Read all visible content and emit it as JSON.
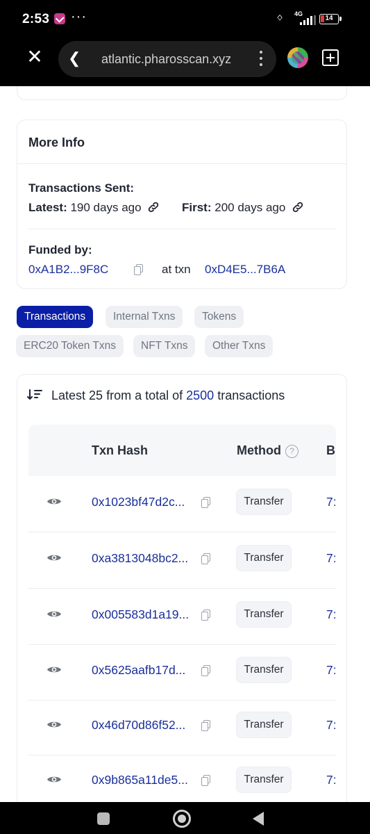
{
  "status_bar": {
    "time": "2:53",
    "dots": "···",
    "network": "4G",
    "battery": "14"
  },
  "browser": {
    "url": "atlantic.pharosscan.xyz"
  },
  "more_info": {
    "title": "More Info",
    "transactions_sent_label": "Transactions Sent:",
    "latest_label": "Latest:",
    "latest_value": "190 days ago",
    "first_label": "First:",
    "first_value": "200 days ago",
    "funded_by_label": "Funded by:",
    "funded_by_address": "0xA1B2...9F8C",
    "at_txn_label": "at txn",
    "funded_txn": "0xD4E5...7B6A"
  },
  "tabs": [
    {
      "label": "Transactions",
      "active": true
    },
    {
      "label": "Internal Txns",
      "active": false
    },
    {
      "label": "Tokens",
      "active": false
    },
    {
      "label": "ERC20 Token Txns",
      "active": false
    },
    {
      "label": "NFT Txns",
      "active": false
    },
    {
      "label": "Other Txns",
      "active": false
    }
  ],
  "tx_summary": {
    "prefix": "Latest 25 from a total of",
    "total": "2500",
    "suffix": "transactions"
  },
  "table": {
    "columns": [
      "Txn Hash",
      "Method",
      "B"
    ],
    "help_glyph": "?",
    "rows": [
      {
        "hash": "0x1023bf47d2c...",
        "method": "Transfer",
        "block_cut": "7:"
      },
      {
        "hash": "0xa3813048bc2...",
        "method": "Transfer",
        "block_cut": "7:"
      },
      {
        "hash": "0x005583d1a19...",
        "method": "Transfer",
        "block_cut": "7:"
      },
      {
        "hash": "0x5625aafb17d...",
        "method": "Transfer",
        "block_cut": "7:"
      },
      {
        "hash": "0x46d70d86f52...",
        "method": "Transfer",
        "block_cut": "7:"
      },
      {
        "hash": "0x9b865a11de5...",
        "method": "Transfer",
        "block_cut": "7:"
      }
    ]
  },
  "colors": {
    "accent": "#0a1ea6",
    "link": "#1a2f9c",
    "tab_bg": "#eef0f4",
    "battery_low": "#e53935"
  },
  "icons": {
    "close": "close-icon",
    "back": "back-chevron-icon",
    "menu": "more-vertical-icon",
    "new_tab": "add-tab-icon",
    "link": "link-icon",
    "copy": "copy-icon",
    "sort": "sort-icon",
    "help": "help-circle-icon",
    "view": "eye-icon"
  }
}
